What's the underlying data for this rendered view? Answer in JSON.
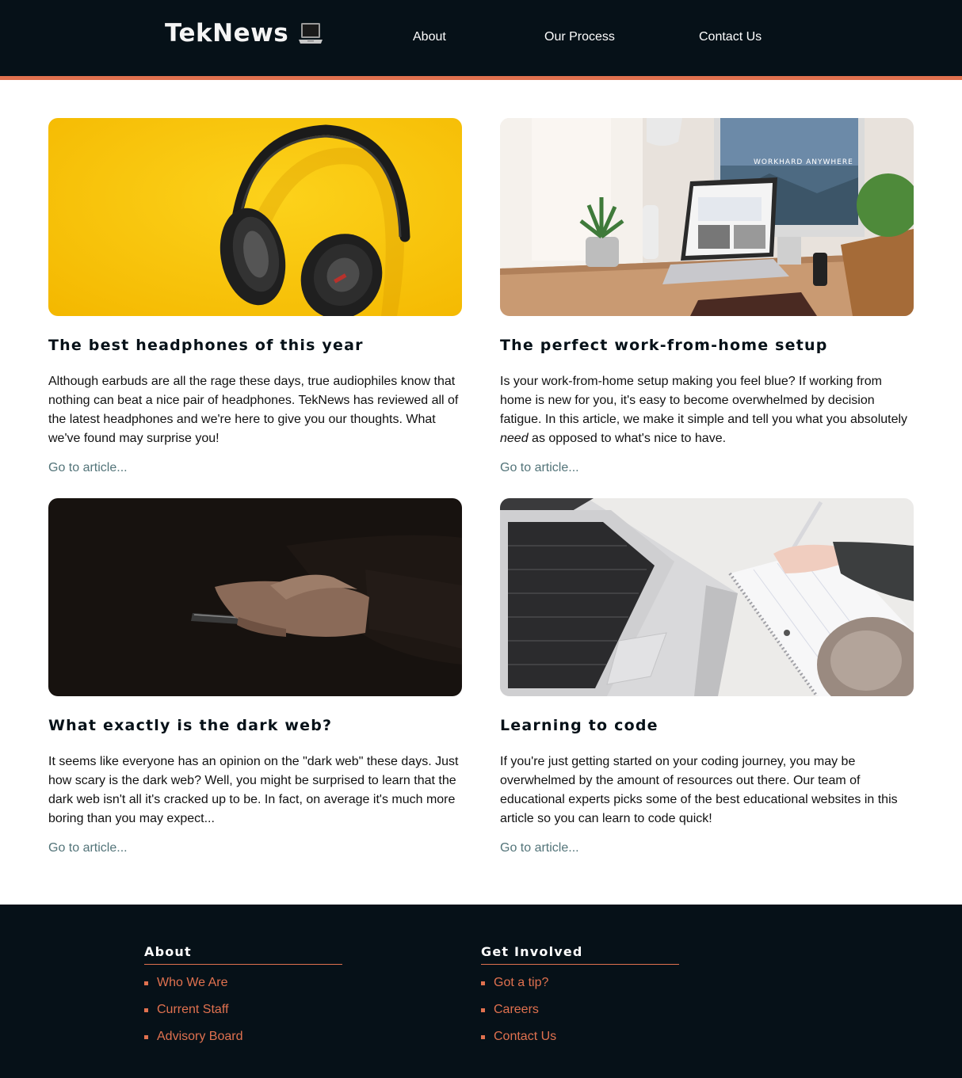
{
  "header": {
    "logo": "TekNews",
    "nav": [
      {
        "label": "About"
      },
      {
        "label": "Our Process"
      },
      {
        "label": "Contact Us"
      }
    ]
  },
  "articles": [
    {
      "title": "The best headphones of this year",
      "text": "Although earbuds are all the rage these days, true audiophiles know that nothing can beat a nice pair of headphones. TekNews has reviewed all of the latest headphones and we're here to give you our thoughts. What we've found may surprise you!",
      "link": "Go to article..."
    },
    {
      "title": "The perfect work-from-home setup",
      "text_before": "Is your work-from-home setup making you feel blue? If working from home is new for you, it's easy to become overwhelmed by decision fatigue. In this article, we make it simple and tell you what you absolutely ",
      "text_emphasis": "need",
      "text_after": " as opposed to what's nice to have.",
      "link": "Go to article...",
      "image_caption": "WORKHARD ANYWHERE"
    },
    {
      "title": "What exactly is the dark web?",
      "text": "It seems like everyone has an opinion on the \"dark web\" these days. Just how scary is the dark web? Well, you might be surprised to learn that the dark web isn't all it's cracked up to be. In fact, on average it's much more boring than you may expect...",
      "link": "Go to article..."
    },
    {
      "title": "Learning to code",
      "text": "If you're just getting started on your coding journey, you may be overwhelmed by the amount of resources out there. Our team of educational experts picks some of the best educational websites in this article so you can learn to code quick!",
      "link": "Go to article..."
    }
  ],
  "footer": {
    "columns": [
      {
        "title": "About",
        "links": [
          "Who We Are",
          "Current Staff",
          "Advisory Board"
        ]
      },
      {
        "title": "Get Involved",
        "links": [
          "Got a tip?",
          "Careers",
          "Contact Us"
        ]
      }
    ]
  },
  "colors": {
    "header_bg": "#061118",
    "accent": "#e0714f",
    "link_teal": "#537479"
  },
  "icons": {
    "logo_icon": "laptop-icon",
    "footer_bullet": "square-bullet-icon"
  }
}
